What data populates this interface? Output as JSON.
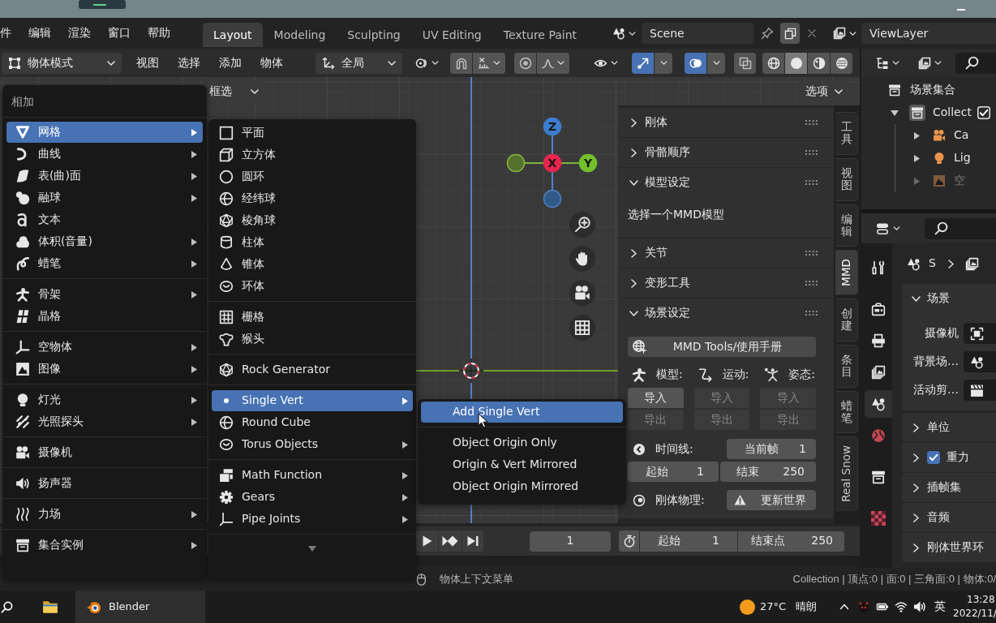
{
  "menu_bar": [
    "件",
    "编辑",
    "渲染",
    "窗口",
    "帮助"
  ],
  "workspace_tabs": [
    {
      "label": "Layout",
      "selected": true
    },
    {
      "label": "Modeling",
      "selected": false
    },
    {
      "label": "Sculpting",
      "selected": false
    },
    {
      "label": "UV Editing",
      "selected": false
    },
    {
      "label": "Texture Paint",
      "selected": false
    }
  ],
  "scene": "Scene",
  "view_layer": "ViewLayer",
  "viewport_header": {
    "mode": "物体模式",
    "menus": [
      "视图",
      "选择",
      "添加",
      "物体"
    ],
    "orientation": "全局",
    "toggles": [
      {
        "kind": "snap",
        "on": false
      },
      {
        "kind": "proportional",
        "on": false
      },
      {
        "kind": "gizmo",
        "on": true
      },
      {
        "kind": "overlay",
        "on": true
      },
      {
        "kind": "xray",
        "on": false
      }
    ],
    "shading": [
      {
        "kind": "wireframe",
        "selected": false
      },
      {
        "kind": "solid",
        "selected": true
      },
      {
        "kind": "material",
        "selected": false
      },
      {
        "kind": "rendered",
        "selected": false
      }
    ]
  },
  "tool_header": {
    "select_mode": "框选",
    "options": "选项"
  },
  "gizmo": {
    "z": "Z",
    "x": "X",
    "y": "Y"
  },
  "add_menu": {
    "title": "相加",
    "groups": [
      [
        {
          "label": "网格",
          "kind": "mesh",
          "submenu": true,
          "selected": true
        },
        {
          "label": "曲线",
          "kind": "curve",
          "submenu": true,
          "selected": false
        },
        {
          "label": "表(曲)面",
          "kind": "surface",
          "submenu": true,
          "selected": false
        },
        {
          "label": "融球",
          "kind": "metaball",
          "submenu": true,
          "selected": false
        },
        {
          "label": "文本",
          "kind": "text",
          "submenu": false,
          "selected": false
        },
        {
          "label": "体积(音量)",
          "kind": "volume",
          "submenu": true,
          "selected": false
        },
        {
          "label": "蜡笔",
          "kind": "grease",
          "submenu": true,
          "selected": false
        }
      ],
      [
        {
          "label": "骨架",
          "kind": "armature",
          "submenu": true,
          "selected": false
        },
        {
          "label": "晶格",
          "kind": "lattice",
          "submenu": false,
          "selected": false
        }
      ],
      [
        {
          "label": "空物体",
          "kind": "empty",
          "submenu": true,
          "selected": false
        },
        {
          "label": "图像",
          "kind": "image",
          "submenu": true,
          "selected": false
        }
      ],
      [
        {
          "label": "灯光",
          "kind": "light",
          "submenu": true,
          "selected": false
        },
        {
          "label": "光照探头",
          "kind": "probe",
          "submenu": true,
          "selected": false
        }
      ],
      [
        {
          "label": "摄像机",
          "kind": "camera",
          "submenu": false,
          "selected": false
        }
      ],
      [
        {
          "label": "扬声器",
          "kind": "speaker",
          "submenu": false,
          "selected": false
        }
      ],
      [
        {
          "label": "力场",
          "kind": "force",
          "submenu": true,
          "selected": false
        }
      ],
      [
        {
          "label": "集合实例",
          "kind": "instance",
          "submenu": true,
          "selected": false
        }
      ]
    ]
  },
  "mesh_menu": {
    "groups": [
      [
        {
          "label": "平面",
          "kind": "plane",
          "submenu": false,
          "selected": false
        },
        {
          "label": "立方体",
          "kind": "cube",
          "submenu": false,
          "selected": false
        },
        {
          "label": "圆环",
          "kind": "circle",
          "submenu": false,
          "selected": false
        },
        {
          "label": "经纬球",
          "kind": "uvsphere",
          "submenu": false,
          "selected": false
        },
        {
          "label": "棱角球",
          "kind": "icosphere",
          "submenu": false,
          "selected": false
        },
        {
          "label": "柱体",
          "kind": "cylinder",
          "submenu": false,
          "selected": false
        },
        {
          "label": "锥体",
          "kind": "cone",
          "submenu": false,
          "selected": false
        },
        {
          "label": "环体",
          "kind": "torus",
          "submenu": false,
          "selected": false
        }
      ],
      [
        {
          "label": "栅格",
          "kind": "grid",
          "submenu": false,
          "selected": false
        },
        {
          "label": "猴头",
          "kind": "monkey",
          "submenu": false,
          "selected": false
        }
      ],
      [
        {
          "label": "Rock Generator",
          "kind": "rock",
          "submenu": false,
          "selected": false
        }
      ],
      [
        {
          "label": "Single Vert",
          "kind": "vertex",
          "submenu": true,
          "selected": true
        },
        {
          "label": "Round Cube",
          "kind": "roundcube",
          "submenu": false,
          "selected": false
        },
        {
          "label": "Torus Objects",
          "kind": "torusobjects",
          "submenu": true,
          "selected": false
        }
      ],
      [
        {
          "label": "Math Function",
          "kind": "math",
          "submenu": true,
          "selected": false
        },
        {
          "label": "Gears",
          "kind": "gears",
          "submenu": true,
          "selected": false
        },
        {
          "label": "Pipe Joints",
          "kind": "pipe",
          "submenu": true,
          "selected": false
        }
      ]
    ],
    "more_below": true
  },
  "vertex_menu": {
    "groups": [
      [
        {
          "label": "Add Single Vert",
          "selected": true
        }
      ],
      [
        {
          "label": "Object Origin Only",
          "selected": false
        },
        {
          "label": "Origin & Vert Mirrored",
          "selected": false
        },
        {
          "label": "Object Origin Mirrored",
          "selected": false
        }
      ]
    ]
  },
  "sidebar_panels": [
    {
      "title": "刚体",
      "expanded": false
    },
    {
      "title": "骨骼顺序",
      "expanded": false
    },
    {
      "title": "模型设定",
      "expanded": true,
      "message": "选择一个MMD模型"
    },
    {
      "title": "关节",
      "expanded": false
    },
    {
      "title": "变形工具",
      "expanded": false
    },
    {
      "title": "场景设定",
      "expanded": true,
      "manual_button": "MMD Tools/使用手册",
      "io": [
        {
          "kind": "model",
          "label": "模型:",
          "import": {
            "label": "导入",
            "disabled": false
          },
          "export": {
            "label": "导出",
            "disabled": true
          }
        },
        {
          "kind": "motion",
          "label": "运动:",
          "import": {
            "label": "导入",
            "disabled": true
          },
          "export": {
            "label": "导出",
            "disabled": true
          }
        },
        {
          "kind": "pose",
          "label": "姿态:",
          "import": {
            "label": "导入",
            "disabled": true
          },
          "export": {
            "label": "导出",
            "disabled": true
          }
        }
      ],
      "timeline": {
        "label": "时间线:",
        "current_label": "当前帧",
        "current": "1",
        "start_label": "起始",
        "start": "1",
        "end_label": "结束",
        "end": "250"
      },
      "rigid_body": {
        "label": "刚体物理:",
        "button": "更新世界"
      }
    }
  ],
  "sidebar_tabs": [
    {
      "label": "工具",
      "selected": false
    },
    {
      "label": "视图",
      "selected": false
    },
    {
      "label": "编辑",
      "selected": false
    },
    {
      "label": "MMD",
      "selected": true
    },
    {
      "label": "创建",
      "selected": false
    },
    {
      "label": "条目",
      "selected": false
    },
    {
      "label": "蜡笔",
      "selected": false
    },
    {
      "label": "Real Snow",
      "selected": false
    }
  ],
  "outliner": {
    "root": "场景集合",
    "items": [
      {
        "label": "Collect",
        "kind": "collection",
        "expanded": true,
        "checked": true,
        "children": [
          {
            "label": "Ca",
            "kind": "camera",
            "expanded": false,
            "dimmed": false
          },
          {
            "label": "Lig",
            "kind": "light",
            "expanded": false,
            "dimmed": false
          },
          {
            "label": "空",
            "kind": "image",
            "expanded": false,
            "dimmed": true
          }
        ]
      }
    ]
  },
  "properties": {
    "tab_groups": [
      [
        {
          "kind": "tool",
          "selected": false
        }
      ],
      [
        {
          "kind": "render",
          "selected": false
        },
        {
          "kind": "output",
          "selected": false
        },
        {
          "kind": "viewlayer",
          "selected": false
        },
        {
          "kind": "scene",
          "selected": true
        },
        {
          "kind": "world",
          "selected": false
        }
      ],
      [
        {
          "kind": "collection",
          "selected": false
        }
      ],
      [
        {
          "kind": "texture",
          "selected": false
        }
      ]
    ],
    "breadcrumb": "S",
    "panels": [
      {
        "title": "场景",
        "expanded": true,
        "fields": [
          {
            "label": "摄像机",
            "kind": "camera"
          },
          {
            "label": "背景场…",
            "kind": "scene"
          },
          {
            "label": "活动剪…",
            "kind": "clip"
          }
        ]
      },
      {
        "title": "单位",
        "expanded": false
      },
      {
        "title": "重力",
        "expanded": false,
        "checked": true
      },
      {
        "title": "插帧集",
        "expanded": false
      },
      {
        "title": "音频",
        "expanded": false
      },
      {
        "title": "刚体世界环",
        "expanded": false
      }
    ]
  },
  "timeline": {
    "frame": "1",
    "start_label": "起始",
    "start": "1",
    "end_label": "结束点",
    "end": "250"
  },
  "status_bar": {
    "hint": "物体上下文菜单",
    "stats": "Collection | 顶点:0 | 面:0 | 三角面:0 | 物体:0/"
  },
  "taskbar": {
    "apps": [
      {
        "kind": "explorer",
        "selected": false
      },
      {
        "kind": "blender",
        "label": "Blender",
        "selected": true
      }
    ],
    "temperature": "27°C",
    "weather": "晴朗",
    "input_method": "英",
    "time": "13:28",
    "date": "2022/11/"
  }
}
